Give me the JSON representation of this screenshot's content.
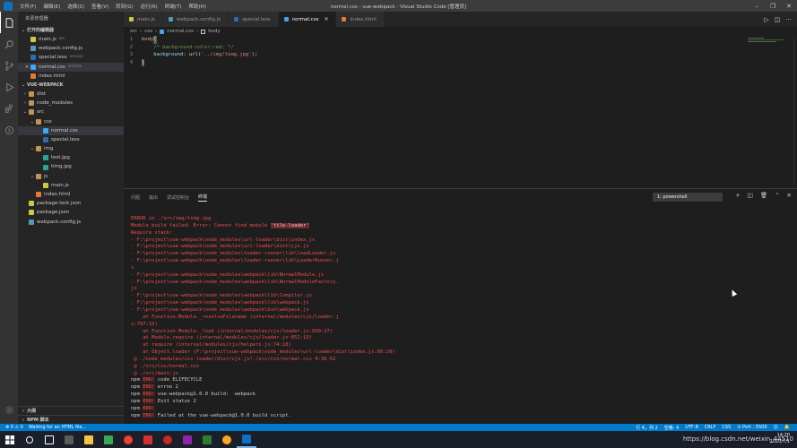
{
  "titlebar": {
    "menu": [
      "文件(F)",
      "编辑(E)",
      "选择(S)",
      "查看(V)",
      "转到(G)",
      "运行(R)",
      "终端(T)",
      "帮助(H)"
    ],
    "title": "normal.css - vue-webpack - Visual Studio Code [管理员]"
  },
  "sidebar": {
    "title": "资源管理器",
    "open_editors_label": "打开的编辑器",
    "open_editors": [
      {
        "name": "main.js",
        "hint": "src",
        "color": "#cbcb41"
      },
      {
        "name": "webpack.config.js",
        "hint": "",
        "color": "#519aba"
      },
      {
        "name": "special.less",
        "hint": "src\\css",
        "color": "#2b6cb0"
      },
      {
        "name": "normal.css",
        "hint": "src\\css",
        "color": "#42a5f5"
      },
      {
        "name": "index.html",
        "hint": "",
        "color": "#e37933"
      }
    ],
    "project_label": "VUE-WEBPACK",
    "tree": [
      {
        "name": "dist",
        "type": "folder"
      },
      {
        "name": "node_modules",
        "type": "folder"
      },
      {
        "name": "src",
        "type": "folder-open"
      },
      {
        "name": "css",
        "type": "folder-open"
      },
      {
        "name": "normal.css",
        "type": "css"
      },
      {
        "name": "special.less",
        "type": "less"
      },
      {
        "name": "img",
        "type": "folder-open"
      },
      {
        "name": "test.jpg",
        "type": "img"
      },
      {
        "name": "timg.jpg",
        "type": "img"
      },
      {
        "name": "js",
        "type": "folder-open"
      },
      {
        "name": "main.js",
        "type": "js"
      },
      {
        "name": "index.html",
        "type": "html"
      },
      {
        "name": "package-lock.json",
        "type": "json"
      },
      {
        "name": "package.json",
        "type": "json"
      },
      {
        "name": "webpack.config.js",
        "type": "config"
      }
    ],
    "outline_label": "大纲",
    "npm_label": "NPM 脚本"
  },
  "tabs": [
    {
      "label": "main.js",
      "color": "#cbcb41",
      "active": false
    },
    {
      "label": "webpack.config.js",
      "color": "#519aba",
      "active": false
    },
    {
      "label": "special.less",
      "color": "#2b6cb0",
      "active": false
    },
    {
      "label": "normal.css",
      "color": "#42a5f5",
      "active": true
    },
    {
      "label": "index.html",
      "color": "#e37933",
      "active": false
    }
  ],
  "breadcrumb": [
    "src",
    "css",
    "normal.css",
    "body"
  ],
  "editor": {
    "lines": [
      {
        "n": "1",
        "selector": "body",
        "brace": "{"
      },
      {
        "n": "2",
        "comment": "/* background-color:red; */"
      },
      {
        "n": "3",
        "prop": "background",
        "punct": ": ",
        "fn": "url",
        "str": "'../img/timg.jpg'",
        "end": ");"
      },
      {
        "n": "4",
        "brace": "}"
      }
    ]
  },
  "panel": {
    "tabs": [
      "问题",
      "输出",
      "调试控制台",
      "终端"
    ],
    "terminal_select": "1: powershell",
    "terminal_lines": [
      {
        "t": "ERROR in ./src/img/timg.jpg"
      },
      {
        "t": "Module build failed: Error: Cannot find module ",
        "hl": "'file-loader'"
      },
      {
        "t": "Require stack:"
      },
      {
        "t": "- F:\\project\\vue-webpack\\node_modules\\url-loader\\dist\\index.js"
      },
      {
        "t": "- F:\\project\\vue-webpack\\node_modules\\url-loader\\dist\\cjs.js"
      },
      {
        "t": "- F:\\project\\vue-webpack\\node_modules\\loader-runner\\lib\\loadLoader.js"
      },
      {
        "t": "- F:\\project\\vue-webpack\\node_modules\\loader-runner\\lib\\LoaderRunner.j"
      },
      {
        "t": "s"
      },
      {
        "t": "- F:\\project\\vue-webpack\\node_modules\\webpack\\lib\\NormalModule.js"
      },
      {
        "t": "- F:\\project\\vue-webpack\\node_modules\\webpack\\lib\\NormalModuleFactory."
      },
      {
        "t": "js"
      },
      {
        "t": "- F:\\project\\vue-webpack\\node_modules\\webpack\\lib\\Compiler.js"
      },
      {
        "t": "- F:\\project\\vue-webpack\\node_modules\\webpack\\lib\\webpack.js"
      },
      {
        "t": "- F:\\project\\vue-webpack\\node_modules\\webpack\\bin\\webpack.js"
      },
      {
        "t": "    at Function.Module._resolveFilename (internal/modules/cjs/loader.j"
      },
      {
        "t": "s:797:15)"
      },
      {
        "t": "    at Function.Module._load (internal/modules/cjs/loader.js:690:27)"
      },
      {
        "t": "    at Module.require (internal/modules/cjs/loader.js:852:19)"
      },
      {
        "t": "    at require (internal/modules/cjs/helpers.js:74:18)"
      },
      {
        "t": "    at Object.loader (F:\\project\\vue-webpack\\node_modules\\url-loader\\dist\\index.js:66:20)"
      },
      {
        "t": " @ ./node_modules/css-loader/dist/cjs.js!./src/css/normal.css 4:36-62"
      },
      {
        "t": " @ ./src/css/normal.css"
      },
      {
        "t": " @ ./src/main.js"
      },
      {
        "npm": "npm",
        "err": "ERR!",
        "rest": " code ELIFECYCLE"
      },
      {
        "npm": "npm",
        "err": "ERR!",
        "rest": " errno 2"
      },
      {
        "npm": "npm",
        "err": "ERR!",
        "rest": " vue-webpack@1.0.0 build: `webpack`"
      },
      {
        "npm": "npm",
        "err": "ERR!",
        "rest": " Exit status 2"
      },
      {
        "npm": "npm",
        "err": "ERR!",
        "rest": ""
      },
      {
        "npm": "npm",
        "err": "ERR!",
        "rest": " Failed at the vue-webpack@1.0.0 build script."
      }
    ]
  },
  "statusbar": {
    "left": [
      "⊗ 0 ⚠ 0",
      "Waiting for an HTML file..."
    ],
    "right": [
      "行 4，列 2",
      "空格: 4",
      "UTF-8",
      "CRLF",
      "CSS",
      "⊙ Port : 5500",
      "☺",
      "🔔"
    ]
  },
  "taskbar": {
    "clock_time": "14:20",
    "clock_date": "2020/7/1"
  },
  "watermark": "https://blog.csdn.net/weixin_44510"
}
